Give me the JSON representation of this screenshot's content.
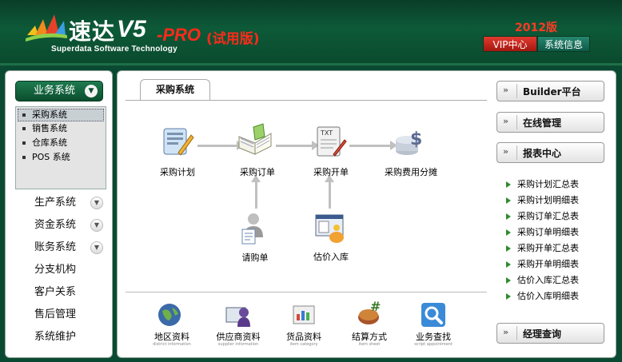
{
  "header": {
    "brand_cn": "速达",
    "brand_ver": "V5",
    "brand_pro": "-PRO",
    "brand_trial": "(试用版)",
    "brand_sub": "Superdata Software Technology",
    "year": "2012版",
    "vip_label": "VIP中心",
    "sysinfo_label": "系统信息"
  },
  "sidebar": {
    "business_label": "业务系统",
    "submenu": [
      "采购系统",
      "销售系统",
      "仓库系统",
      "POS 系统"
    ],
    "nav": [
      {
        "label": "生产系统",
        "expandable": true
      },
      {
        "label": "资金系统",
        "expandable": true
      },
      {
        "label": "账务系统",
        "expandable": true
      },
      {
        "label": "分支机构",
        "expandable": false
      },
      {
        "label": "客户关系",
        "expandable": false
      },
      {
        "label": "售后管理",
        "expandable": false
      },
      {
        "label": "系统维护",
        "expandable": false
      }
    ]
  },
  "main": {
    "tab_label": "采购系统",
    "flow": {
      "plan": "采购计划",
      "order": "采购订单",
      "invoice": "采购开单",
      "expense": "采购费用分摊",
      "request": "请购单",
      "estimate": "估价入库"
    },
    "bottom": [
      {
        "label": "地区资料",
        "sub": "district information"
      },
      {
        "label": "供应商资料",
        "sub": "supplier information"
      },
      {
        "label": "货品资料",
        "sub": "item category"
      },
      {
        "label": "结算方式",
        "sub": "item sheet"
      },
      {
        "label": "业务查找",
        "sub": "script appointment"
      }
    ]
  },
  "right": {
    "builder": "Builder平台",
    "online": "在线管理",
    "report": "报表中心",
    "reports": [
      "采购计划汇总表",
      "采购计划明细表",
      "采购订单汇总表",
      "采购订单明细表",
      "采购开单汇总表",
      "采购开单明细表",
      "估价入库汇总表",
      "估价入库明细表"
    ],
    "manager": "经理查询"
  }
}
